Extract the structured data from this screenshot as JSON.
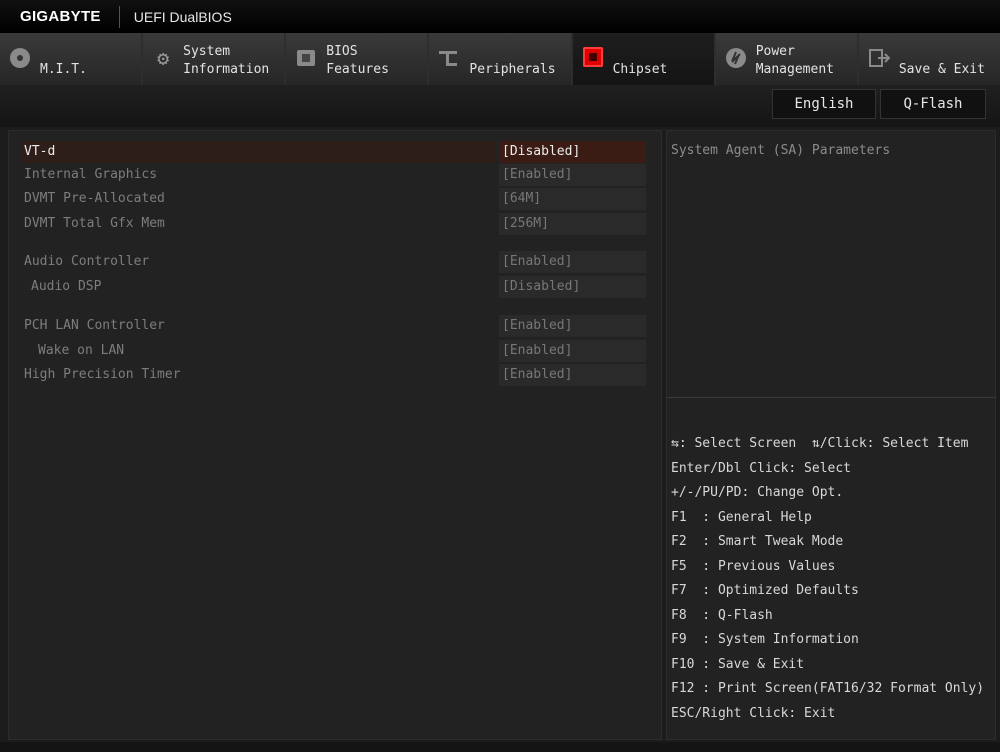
{
  "header": {
    "brand": "GIGABYTE",
    "product": "UEFI DualBIOS"
  },
  "tabs": [
    {
      "label": "M.I.T.",
      "icon": "disc-icon",
      "active": false
    },
    {
      "label": "System\nInformation",
      "icon": "gear-icon",
      "active": false
    },
    {
      "label": "BIOS\nFeatures",
      "icon": "bios-chip-icon",
      "active": false
    },
    {
      "label": "Peripherals",
      "icon": "peripheral-icon",
      "active": false
    },
    {
      "label": "Chipset",
      "icon": "chipset-icon",
      "active": true
    },
    {
      "label": "Power\nManagement",
      "icon": "power-icon",
      "active": false
    },
    {
      "label": "Save & Exit",
      "icon": "exit-icon",
      "active": false
    }
  ],
  "subbar": {
    "language": "English",
    "qflash": "Q-Flash"
  },
  "settings": [
    {
      "label": "VT-d",
      "value": "[Disabled]"
    },
    {
      "label": "Internal Graphics",
      "value": "[Enabled]"
    },
    {
      "label": "DVMT Pre-Allocated",
      "value": "[64M]"
    },
    {
      "label": "DVMT Total Gfx Mem",
      "value": "[256M]"
    },
    {
      "label": "Audio Controller",
      "value": "[Enabled]"
    },
    {
      "label": "Audio DSP",
      "value": "[Disabled]"
    },
    {
      "label": "PCH LAN Controller",
      "value": "[Enabled]"
    },
    {
      "label": "Wake on LAN",
      "value": "[Enabled]"
    },
    {
      "label": "High Precision Timer",
      "value": "[Enabled]"
    }
  ],
  "help": {
    "description": "System Agent (SA) Parameters",
    "keys": [
      "⇆: Select Screen  ⇅/Click: Select Item",
      "Enter/Dbl Click: Select",
      "+/-/PU/PD: Change Opt.",
      "F1  : General Help",
      "F2  : Smart Tweak Mode",
      "F5  : Previous Values",
      "F7  : Optimized Defaults",
      "F8  : Q-Flash",
      "F9  : System Information",
      "F10 : Save & Exit",
      "F12 : Print Screen(FAT16/32 Format Only)",
      "ESC/Right Click: Exit"
    ]
  },
  "colors": {
    "accent": "#e00000",
    "selected_row": "#2e1e1a"
  }
}
